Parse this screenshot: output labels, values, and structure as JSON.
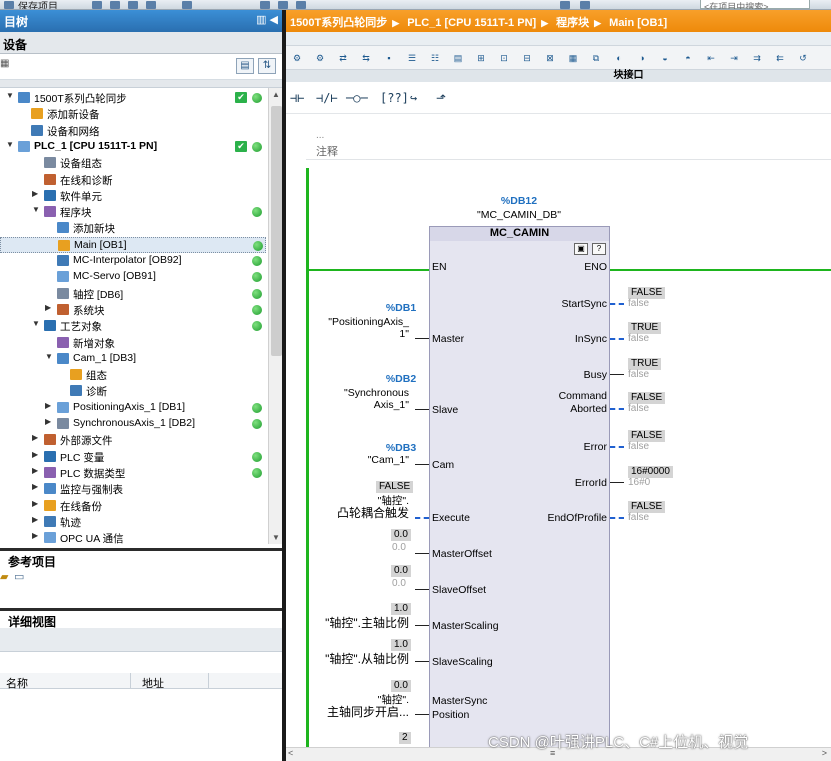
{
  "topbar": {
    "save_label": "保存项目",
    "search_placeholder": "<在项目中搜索>"
  },
  "left": {
    "project_tree_title": "目树",
    "devices_tab": "设备",
    "tree": [
      {
        "label": "1500T系列凸轮同步",
        "level": 0,
        "tw": "▼",
        "check": true,
        "dot": true
      },
      {
        "label": "添加新设备",
        "level": 1,
        "tw": "",
        "check": false,
        "dot": false
      },
      {
        "label": "设备和网络",
        "level": 1,
        "tw": "",
        "check": false,
        "dot": false
      },
      {
        "label": "PLC_1 [CPU 1511T-1 PN]",
        "level": 0,
        "tw": "▼",
        "check": true,
        "dot": true,
        "bold": true
      },
      {
        "label": "设备组态",
        "level": 2,
        "tw": "",
        "check": false,
        "dot": false
      },
      {
        "label": "在线和诊断",
        "level": 2,
        "tw": "",
        "check": false,
        "dot": false
      },
      {
        "label": "软件单元",
        "level": 2,
        "tw": "▶",
        "check": false,
        "dot": false
      },
      {
        "label": "程序块",
        "level": 2,
        "tw": "▼",
        "check": false,
        "dot": true
      },
      {
        "label": "添加新块",
        "level": 3,
        "tw": "",
        "check": false,
        "dot": false
      },
      {
        "label": "Main [OB1]",
        "level": 3,
        "tw": "",
        "check": false,
        "dot": true,
        "selected": true
      },
      {
        "label": "MC-Interpolator [OB92]",
        "level": 3,
        "tw": "",
        "check": false,
        "dot": true
      },
      {
        "label": "MC-Servo [OB91]",
        "level": 3,
        "tw": "",
        "check": false,
        "dot": true
      },
      {
        "label": "轴控 [DB6]",
        "level": 3,
        "tw": "",
        "check": false,
        "dot": true
      },
      {
        "label": "系统块",
        "level": 3,
        "tw": "▶",
        "check": false,
        "dot": true
      },
      {
        "label": "工艺对象",
        "level": 2,
        "tw": "▼",
        "check": false,
        "dot": true
      },
      {
        "label": "新增对象",
        "level": 3,
        "tw": "",
        "check": false,
        "dot": false
      },
      {
        "label": "Cam_1 [DB3]",
        "level": 3,
        "tw": "▼",
        "check": false,
        "dot": false
      },
      {
        "label": "组态",
        "level": 4,
        "tw": "",
        "check": false,
        "dot": false
      },
      {
        "label": "诊断",
        "level": 4,
        "tw": "",
        "check": false,
        "dot": false
      },
      {
        "label": "PositioningAxis_1 [DB1]",
        "level": 3,
        "tw": "▶",
        "check": false,
        "dot": true
      },
      {
        "label": "SynchronousAxis_1 [DB2]",
        "level": 3,
        "tw": "▶",
        "check": false,
        "dot": true
      },
      {
        "label": "外部源文件",
        "level": 2,
        "tw": "▶",
        "check": false,
        "dot": false
      },
      {
        "label": "PLC 变量",
        "level": 2,
        "tw": "▶",
        "check": false,
        "dot": true
      },
      {
        "label": "PLC 数据类型",
        "level": 2,
        "tw": "▶",
        "check": false,
        "dot": true
      },
      {
        "label": "监控与强制表",
        "level": 2,
        "tw": "▶",
        "check": false,
        "dot": false
      },
      {
        "label": "在线备份",
        "level": 2,
        "tw": "▶",
        "check": false,
        "dot": false
      },
      {
        "label": "轨迹",
        "level": 2,
        "tw": "▶",
        "check": false,
        "dot": false
      },
      {
        "label": "OPC UA 通信",
        "level": 2,
        "tw": "▶",
        "check": false,
        "dot": false
      }
    ],
    "reference_title": "参考项目",
    "details_title": "详细视图",
    "col_name": "名称",
    "col_address": "地址"
  },
  "editor": {
    "breadcrumb": [
      "1500T系列凸轮同步",
      "PLC_1 [CPU 1511T-1 PN]",
      "程序块",
      "Main [OB1]"
    ],
    "interface_label": "块接口",
    "comment_label": "注释",
    "comment_cut": "...",
    "block": {
      "db": "%DB12",
      "instance": "\"MC_CAMIN_DB\"",
      "title": "MC_CAMIN",
      "inputs": [
        "EN",
        "Master",
        "Slave",
        "Cam",
        "Execute",
        "MasterOffset",
        "SlaveOffset",
        "MasterScaling",
        "SlaveScaling",
        "MasterSync",
        "Position"
      ],
      "outputs": [
        "ENO",
        "StartSync",
        "InSync",
        "Busy",
        "Command",
        "Aborted",
        "Error",
        "ErrorId",
        "EndOfProfile"
      ]
    },
    "operands": {
      "master_db": "%DB1",
      "master_name1": "\"PositioningAxis_",
      "master_name2": "1\"",
      "slave_db": "%DB2",
      "slave_name1": "\"Synchronous",
      "slave_name2": "Axis_1\"",
      "cam_db": "%DB3",
      "cam_name": "\"Cam_1\"",
      "execute_val": "FALSE",
      "execute_name1": "\"轴控\".",
      "execute_name2": "凸轮耦合触发",
      "moffset_val": "0.0",
      "moffset_fade": "0.0",
      "soffset_val": "0.0",
      "soffset_fade": "0.0",
      "mscale_val": "1.0",
      "mscale_name": "\"轴控\".主轴比例",
      "sscale_val": "1.0",
      "sscale_name": "\"轴控\".从轴比例",
      "msync_val": "0.0",
      "msync_name1": "\"轴控\".",
      "msync_name2": "主轴同步开启...",
      "next_val": "2"
    },
    "outputs_values": {
      "startsync": "FALSE",
      "startsync_fade": "false",
      "insync": "TRUE",
      "insync_fade": "false",
      "busy": "TRUE",
      "busy_fade": "false",
      "aborted": "FALSE",
      "aborted_fade": "false",
      "error": "FALSE",
      "error_fade": "false",
      "errorid": "16#0000",
      "errorid_fade": "16#0",
      "endofprofile": "FALSE",
      "endofprofile_fade": "false"
    }
  },
  "watermark": "CSDN @叶强讲PLC、C#上位机、视觉",
  "colors": {
    "accent_orange": "#ee8a0a",
    "tree_blue": "#2a6fb0",
    "status_green": "#1d9c2e",
    "wire_green": "#1eb51e",
    "bool_blue": "#2060d0"
  }
}
